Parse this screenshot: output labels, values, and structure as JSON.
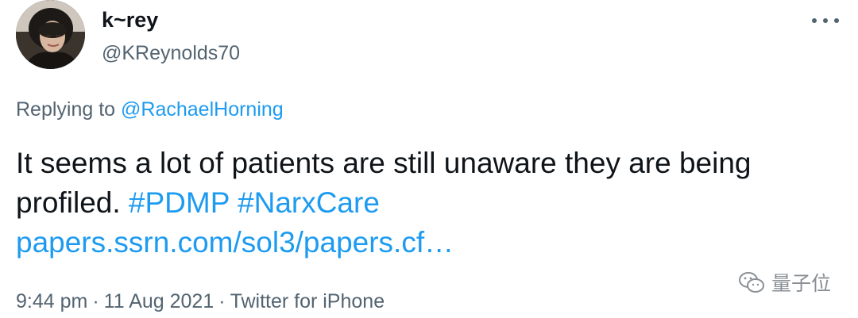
{
  "author": {
    "display_name": "k~rey",
    "handle": "@KReynolds70",
    "avatar_icon": "profile-photo"
  },
  "reply": {
    "prefix": "Replying to",
    "mention": "@RachaelHorning"
  },
  "tweet": {
    "text": "It seems a lot of patients are still unaware they are being profiled.",
    "hashtag_1": "#PDMP",
    "hashtag_2": "#NarxCare",
    "link": "papers.ssrn.com/sol3/papers.cf…"
  },
  "meta": {
    "time": "9:44 pm",
    "date": "11 Aug 2021",
    "separator": "·",
    "source": "Twitter for iPhone"
  },
  "watermark": {
    "icon": "wechat-icon",
    "text": "量子位"
  },
  "colors": {
    "link": "#1d9bf0",
    "secondary_text": "#536471",
    "primary_text": "#0f1419"
  }
}
